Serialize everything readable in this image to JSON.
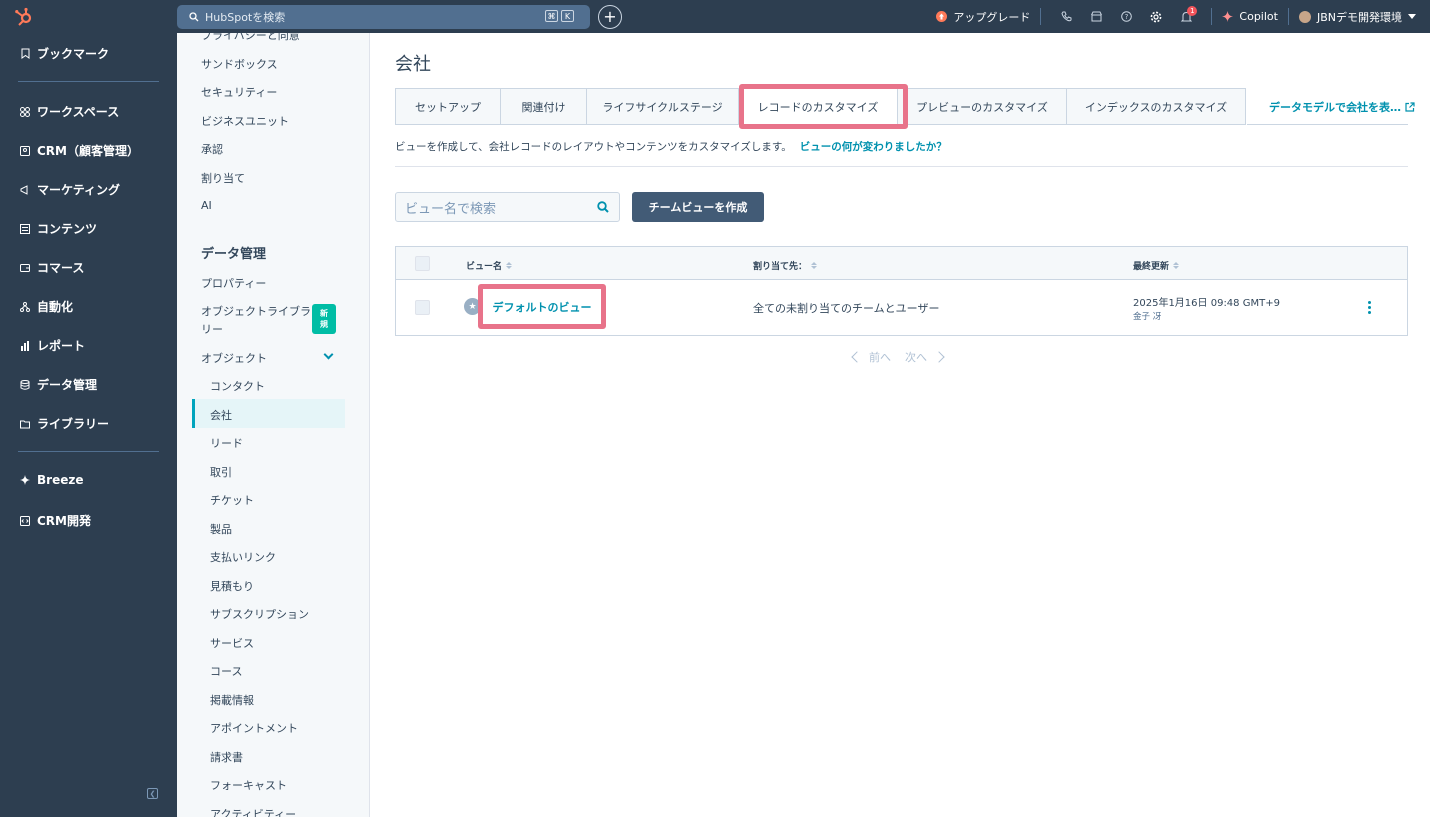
{
  "topbar": {
    "search_placeholder": "HubSpotを検索",
    "shortcut_keys": [
      "⌘",
      "K"
    ],
    "upgrade_label": "アップグレード",
    "notification_count": "1",
    "copilot_label": "Copilot",
    "account_label": "JBNデモ開発環境"
  },
  "leftnav": {
    "items": [
      {
        "label": "ブックマーク",
        "icon": "bookmark-icon"
      },
      {
        "label": "ワークスペース",
        "icon": "workspace-icon"
      },
      {
        "label": "CRM（顧客管理）",
        "icon": "crm-icon"
      },
      {
        "label": "マーケティング",
        "icon": "megaphone-icon"
      },
      {
        "label": "コンテンツ",
        "icon": "content-icon"
      },
      {
        "label": "コマース",
        "icon": "commerce-icon"
      },
      {
        "label": "自動化",
        "icon": "automation-icon"
      },
      {
        "label": "レポート",
        "icon": "reports-icon"
      },
      {
        "label": "データ管理",
        "icon": "database-icon"
      },
      {
        "label": "ライブラリー",
        "icon": "folder-icon"
      },
      {
        "label": "Breeze",
        "icon": "sparkle-icon"
      },
      {
        "label": "CRM開発",
        "icon": "code-icon"
      }
    ]
  },
  "settings": {
    "top_items": [
      "プライバシーと同意",
      "サンドボックス",
      "セキュリティー",
      "ビジネスユニット",
      "承認",
      "割り当て",
      "AI"
    ],
    "section_heading": "データ管理",
    "data_items": [
      "プロパティー",
      "オブジェクトライブラリー",
      "オブジェクト"
    ],
    "new_badge": [
      "新",
      "規"
    ],
    "object_items": [
      "コンタクト",
      "会社",
      "リード",
      "取引",
      "チケット",
      "製品",
      "支払いリンク",
      "見積もり",
      "サブスクリプション",
      "サービス",
      "コース",
      "掲載情報",
      "アポイントメント",
      "請求書",
      "フォーキャスト",
      "アクティビティー"
    ]
  },
  "main": {
    "title": "会社",
    "tabs": [
      "セットアップ",
      "関連付け",
      "ライフサイクルステージ",
      "レコードのカスタマイズ",
      "プレビューのカスタマイズ",
      "インデックスのカスタマイズ"
    ],
    "external_link": "データモデルで会社を表…",
    "description": "ビューを作成して、会社レコードのレイアウトやコンテンツをカスタマイズします。",
    "description_link": "ビューの何が変わりましたか？",
    "view_search_placeholder": "ビュー名で検索",
    "create_button": "チームビューを作成",
    "table": {
      "headers": [
        "ビュー名",
        "割り当て先：",
        "最終更新"
      ],
      "rows": [
        {
          "name": "デフォルトのビュー",
          "assigned": "全ての未割り当てのチームとユーザー",
          "updated": "2025年1月16日 09:48 GMT+9",
          "updated_by": "金子 冴"
        }
      ]
    },
    "pager": {
      "prev": "前へ",
      "next": "次へ"
    }
  }
}
